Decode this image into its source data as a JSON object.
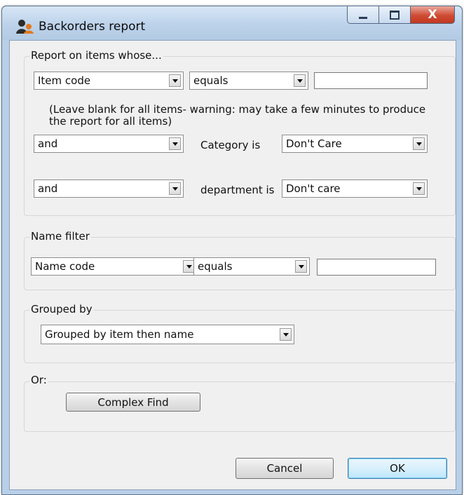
{
  "window": {
    "title": "Backorders report",
    "close_glyph": "X",
    "icons": {
      "app": "person-app-icon",
      "minimize": "minimize-icon",
      "maximize": "maximize-icon",
      "close": "close-icon"
    }
  },
  "report_group": {
    "label": "Report on items whose...",
    "row1": {
      "field": "Item code",
      "operator": "equals",
      "value": ""
    },
    "note": "(Leave blank for all items- warning: may take a few minutes to produce the report for all items)",
    "row2": {
      "conjunction": "and",
      "label": "Category is",
      "value": "Don't Care"
    },
    "row3": {
      "conjunction": "and",
      "label": "department is",
      "value": "Don't care"
    }
  },
  "name_filter": {
    "label": "Name filter",
    "field": "Name code",
    "operator": "equals",
    "value": ""
  },
  "grouped_by": {
    "label": "Grouped by",
    "value": "Grouped by item then name"
  },
  "or_group": {
    "label": "Or:",
    "complex_find_label": "Complex Find"
  },
  "buttons": {
    "cancel_label": "Cancel",
    "ok_label": "OK"
  }
}
